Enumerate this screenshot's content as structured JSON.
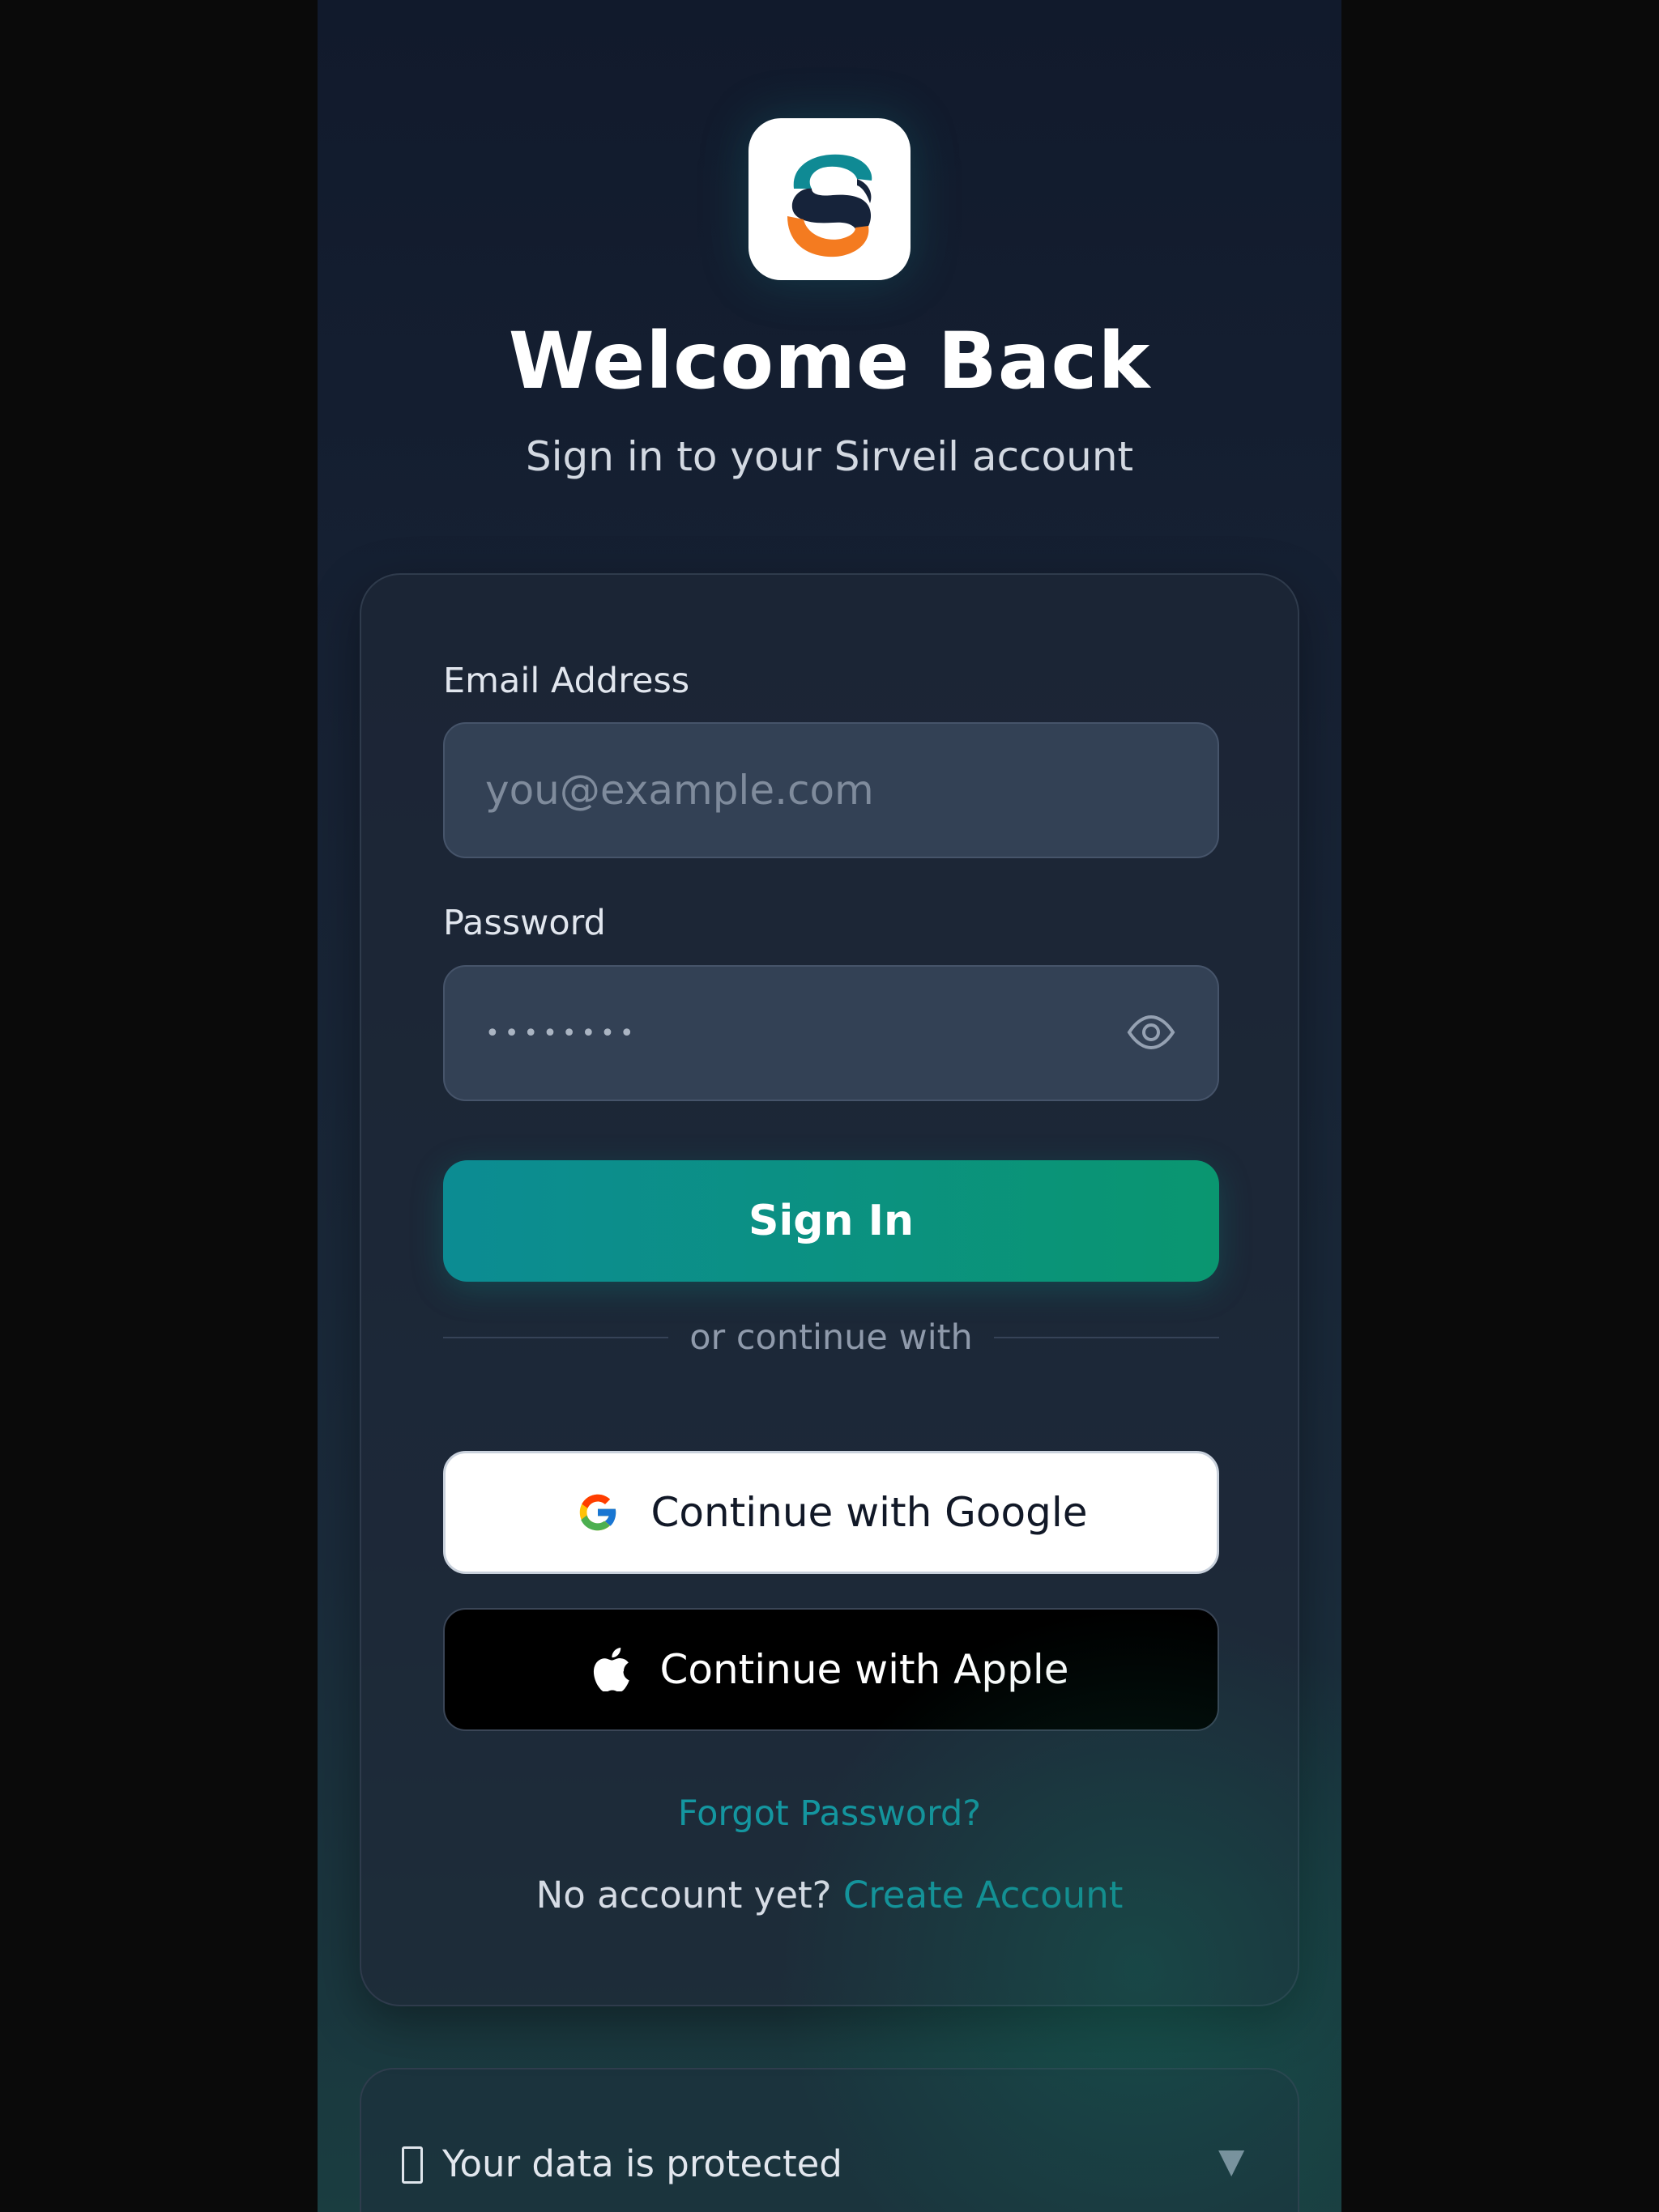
{
  "header": {
    "title": "Welcome Back",
    "subtitle": "Sign in to your Sirveil account"
  },
  "brand": {
    "logo_icon": "sirveil-s-logo",
    "colors": {
      "teal": "#0f8a94",
      "navy": "#16233a",
      "orange": "#f47b20"
    }
  },
  "form": {
    "email": {
      "label": "Email Address",
      "placeholder": "you@example.com",
      "value": ""
    },
    "password": {
      "label": "Password",
      "value": "••••••••",
      "toggle_icon": "eye-icon"
    },
    "submit_label": "Sign In"
  },
  "divider_text": "or continue with",
  "social": {
    "google_label": "Continue with Google",
    "apple_label": "Continue with Apple"
  },
  "links": {
    "forgot": "Forgot Password?",
    "no_account": "No account yet?",
    "create": "Create Account"
  },
  "security": {
    "label": "Your data is protected",
    "chevron": "▼"
  },
  "theme": {
    "accent": "#1496a0",
    "button_gradient": [
      "#0c8c93",
      "#0a9670"
    ],
    "background": "#111a2c"
  }
}
